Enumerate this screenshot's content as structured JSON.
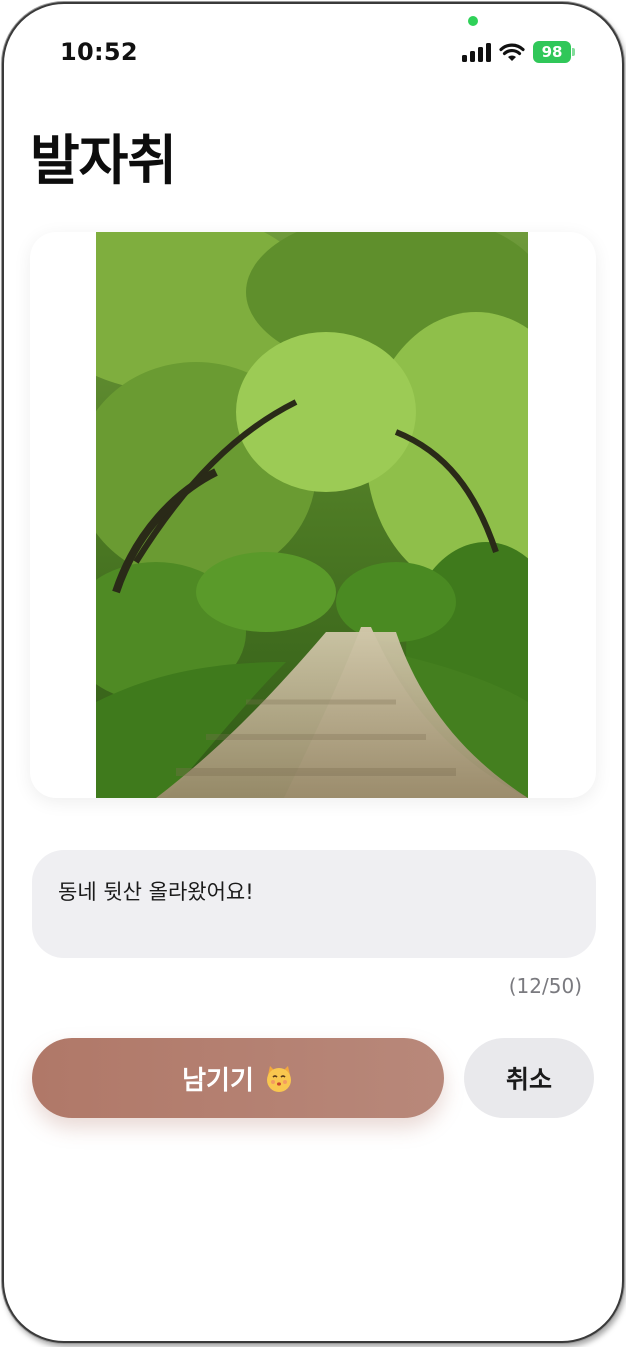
{
  "status_bar": {
    "time": "10:52",
    "battery": "98",
    "icons": [
      "signal-icon",
      "wifi-icon",
      "battery-icon"
    ]
  },
  "header": {
    "title": "발자취"
  },
  "photo": {
    "icon": "forest-path-photo"
  },
  "caption": {
    "value": "동네 뒷산 올라왔어요!",
    "counter": "(12/50)"
  },
  "actions": {
    "submit_label": "남기기",
    "submit_icon": "cat-kissing-emoji-icon",
    "cancel_label": "취소"
  },
  "colors": {
    "accent": "#b07868",
    "battery": "#30c759",
    "input_bg": "#efeff2",
    "cancel_bg": "#e9e9ec"
  }
}
